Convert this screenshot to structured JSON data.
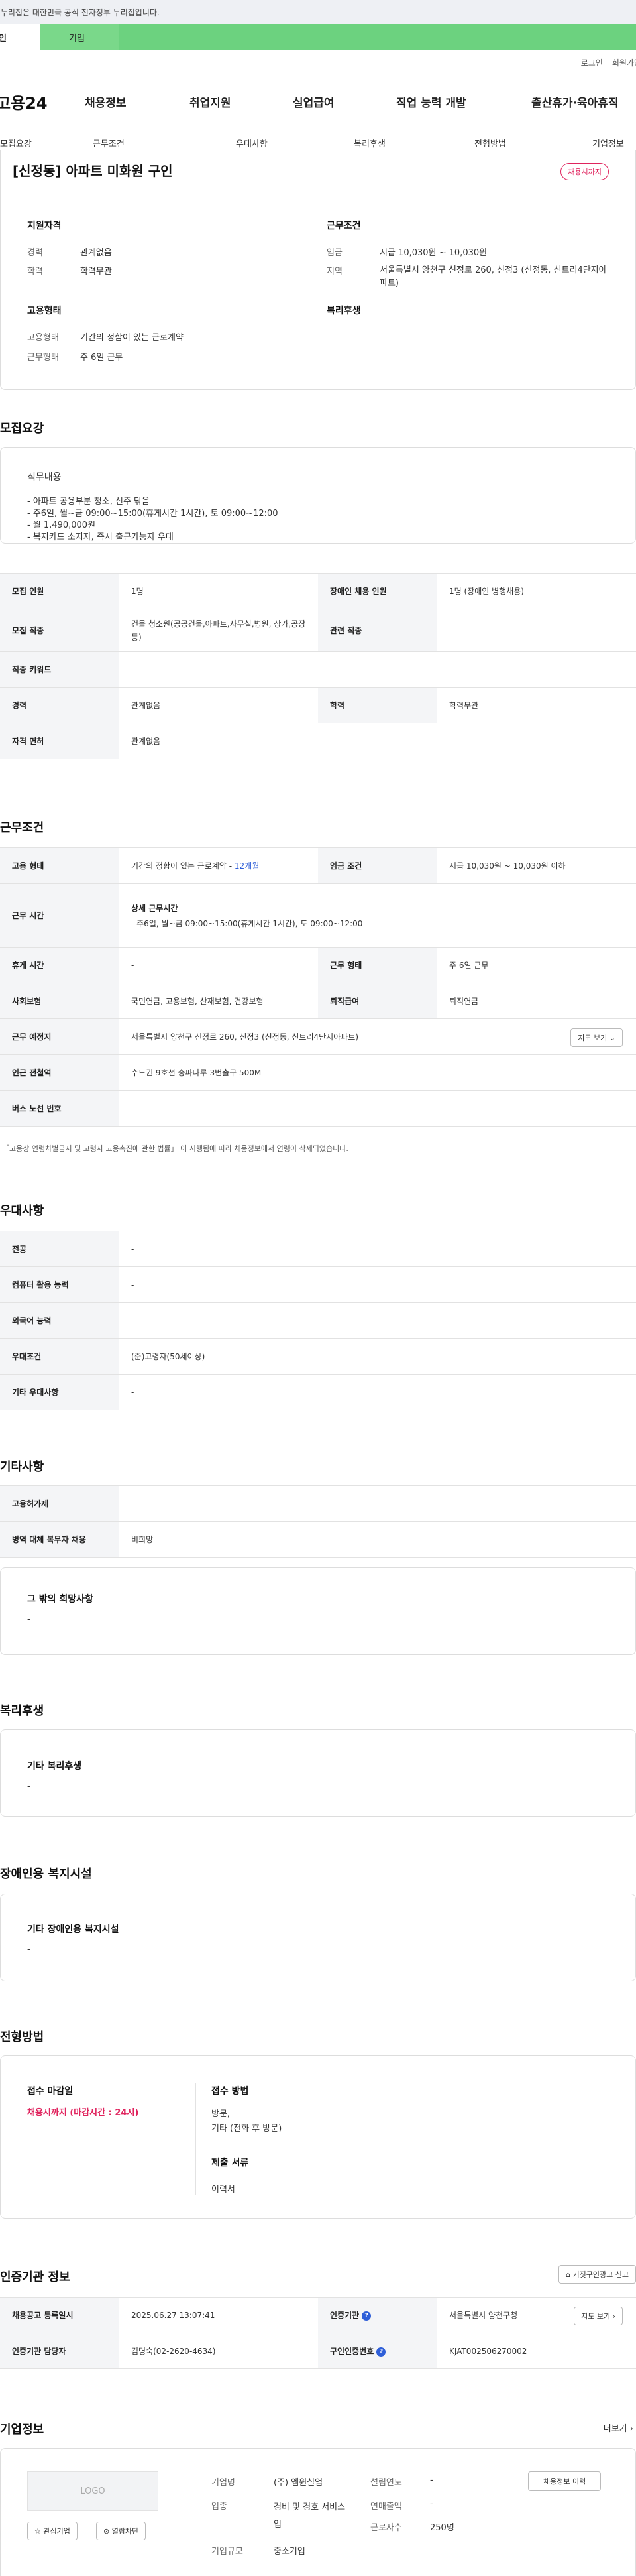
{
  "gov_notice": "이 누리집은 대한민국 공식 전자정부 누리집입니다.",
  "tabs": {
    "personal": "개인",
    "company": "기업"
  },
  "util": {
    "login": "로그인",
    "signup": "회원가입"
  },
  "gnb": {
    "logo": "고용24",
    "items": [
      "채용정보",
      "취업지원",
      "실업급여",
      "직업 능력 개발",
      "출산휴가·육아휴직"
    ]
  },
  "subnav": [
    "모집요강",
    "근무조건",
    "우대사항",
    "복리후생",
    "전형방법",
    "기업정보"
  ],
  "summary": {
    "title": "[신정동] 아파트 미화원 구인",
    "badge": "채용시까지",
    "qual_heading": "지원자격",
    "qual": [
      {
        "label": "경력",
        "value": "관계없음"
      },
      {
        "label": "학력",
        "value": "학력무관"
      }
    ],
    "cond_heading": "근무조건",
    "cond": [
      {
        "label": "임금",
        "value": "시급 10,030원 ~ 10,030원"
      },
      {
        "label": "지역",
        "value": "서울특별시 양천구 신정로 260, 신정3 (신정동, 신트리4단지아파트)"
      }
    ],
    "emp_heading": "고용형태",
    "emp": [
      {
        "label": "고용형태",
        "value": "기간의 정함이 있는 근로계약"
      },
      {
        "label": "근무형태",
        "value": "주 6일 근무"
      }
    ],
    "welfare_heading": "복리후생"
  },
  "recruit": {
    "title": "모집요강",
    "duty_heading": "직무내용",
    "duty_lines": [
      "- 아파트 공용부분 청소, 신주 닦음",
      "- 주6일, 월~금 09:00~15:00(휴게시간 1시간), 토 09:00~12:00",
      "- 월 1,490,000원",
      "- 복지카드 소지자, 즉시 출근가능자 우대"
    ],
    "rows": [
      {
        "l1": "모집 인원",
        "v1": "1명",
        "l2": "장애인 채용 인원",
        "v2": "1명 (장애인 병행채용)"
      },
      {
        "l1": "모집 직종",
        "v1": "건물 청소원(공공건물,아파트,사무실,병원, 상가,공장 등)",
        "l2": "관련 직종",
        "v2": "-"
      },
      {
        "l1": "직종 키워드",
        "v1": "-"
      },
      {
        "l1": "경력",
        "v1": "관계없음",
        "l2": "학력",
        "v2": "학력무관"
      },
      {
        "l1": "자격 면허",
        "v1": "관계없음"
      }
    ]
  },
  "work": {
    "title": "근무조건",
    "emp_label": "고용 형태",
    "emp_value": "기간의 정함이 있는 근로계약 - ",
    "emp_months": "12개월",
    "wage_label": "임금 조건",
    "wage_value": "시급 10,030원 ~ 10,030원 이하",
    "hours_label": "근무 시간",
    "hours_sub": "상세 근무시간",
    "hours_value": "- 주6일, 월~금 09:00~15:00(휴게시간 1시간), 토 09:00~12:00",
    "rest_label": "휴게 시간",
    "rest_value": "-",
    "form_label": "근무 형태",
    "form_value": "주 6일 근무",
    "ins_label": "사회보험",
    "ins_value": "국민연금, 고용보험, 산재보험, 건강보험",
    "sev_label": "퇴직급여",
    "sev_value": "퇴직연금",
    "place_label": "근무 예정지",
    "place_value": "서울특별시 양천구 신정로 260, 신정3 (신정동, 신트리4단지아파트)",
    "map_btn": "지도 보기",
    "subway_label": "인근 전철역",
    "subway_value": "수도권 9호선 송파나루 3번출구 500M",
    "bus_label": "버스 노선 번호",
    "bus_value": "-",
    "note": "* 「고용상 연령차별금지 및 고령자 고용촉진에 관한 법률」 이 시행됨에 따라 채용정보에서 연령이 삭제되었습니다."
  },
  "pref": {
    "title": "우대사항",
    "rows": [
      {
        "label": "전공",
        "value": "-"
      },
      {
        "label": "컴퓨터 활용 능력",
        "value": "-"
      },
      {
        "label": "외국어 능력",
        "value": "-"
      },
      {
        "label": "우대조건",
        "value": "(준)고령자(50세이상)"
      },
      {
        "label": "기타 우대사항",
        "value": "-"
      }
    ]
  },
  "etc": {
    "title": "기타사항",
    "rows": [
      {
        "label": "고용허가제",
        "value": "-"
      },
      {
        "label": "병역 대체 복무자 채용",
        "value": "비희망"
      }
    ],
    "box_heading": "그 밖의 희망사항",
    "box_value": "-"
  },
  "welfare": {
    "title": "복리후생",
    "box_heading": "기타 복리후생",
    "box_value": "-"
  },
  "disabled": {
    "title": "장애인용 복지시설",
    "box_heading": "기타 장애인용 복지시설",
    "box_value": "-"
  },
  "selection": {
    "title": "전형방법",
    "deadline_heading": "접수 마감일",
    "deadline_value": "채용시까지 (마감시간 : 24시)",
    "method_heading": "접수 방법",
    "method_lines": [
      "방문,",
      "기타 (전화 후 방문)"
    ],
    "docs_heading": "제출 서류",
    "docs_value": "이력서"
  },
  "cert": {
    "title": "인증기관 정보",
    "report_btn": "거짓구인광고 신고",
    "r1l1": "채용공고 등록일시",
    "r1v1": "2025.06.27 13:07:41",
    "r1l2": "인증기관",
    "r1v2": "서울특별시 양천구청",
    "r1btn": "지도 보기",
    "r2l1": "인증기관 담당자",
    "r2v1": "김명숙(02-2620-4634)",
    "r2l2": "구인인증번호",
    "r2v2": "KJAT002506270002"
  },
  "company": {
    "title": "기업정보",
    "more": "더보기",
    "logo_text": "LOGO",
    "interest_btn": "관심기업",
    "block_btn": "열람차단",
    "name_label": "기업명",
    "name_value": "(주) 엠원실업",
    "industry_label": "업종",
    "industry_value": "경비 및 경호 서비스업",
    "size_label": "기업규모",
    "size_value": "중소기업",
    "founded_label": "설립연도",
    "founded_value": "-",
    "sales_label": "연매출액",
    "sales_value": "-",
    "staff_label": "근로자수",
    "staff_value": "250명",
    "jobs_btn": "채용정보 이력"
  }
}
